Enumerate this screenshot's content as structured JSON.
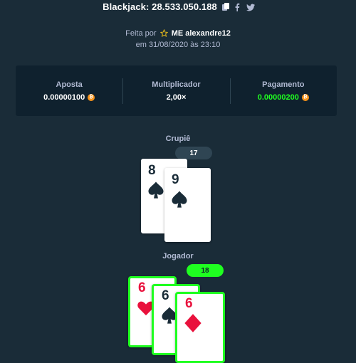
{
  "header": {
    "title": "Blackjack: 28.533.050.188",
    "icons": [
      "copy-icon",
      "facebook-icon",
      "twitter-icon"
    ]
  },
  "meta": {
    "prefix": "Feita por",
    "user": "ME alexandre12",
    "date": "em 31/08/2020 às 23:10"
  },
  "stats": {
    "bet_label": "Aposta",
    "bet_value": "0.00000100",
    "multiplier_label": "Multiplicador",
    "multiplier_value": "2,00×",
    "payout_label": "Pagamento",
    "payout_value": "0.00000200",
    "currency_icon": "bitcoin-icon"
  },
  "dealer": {
    "label": "Crupiê",
    "total": "17",
    "cards": [
      {
        "rank": "8",
        "suit": "spade"
      },
      {
        "rank": "9",
        "suit": "spade"
      }
    ]
  },
  "player": {
    "label": "Jogador",
    "total": "18",
    "cards": [
      {
        "rank": "6",
        "suit": "heart"
      },
      {
        "rank": "6",
        "suit": "spade"
      },
      {
        "rank": "6",
        "suit": "diamond"
      }
    ]
  },
  "colors": {
    "background": "#1a2c38",
    "panel": "#0f212e",
    "win_green": "#1fff20",
    "red_suit": "#e9113c"
  }
}
